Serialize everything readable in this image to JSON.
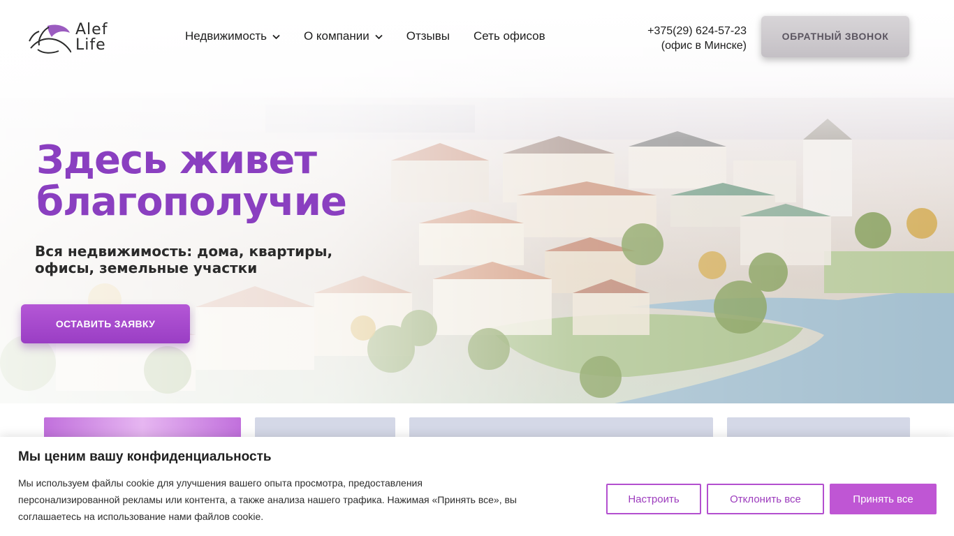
{
  "brand": {
    "line1": "Alef",
    "line2": "Life"
  },
  "nav": {
    "items": [
      {
        "label": "Недвижимость",
        "has_dropdown": true
      },
      {
        "label": "О компании",
        "has_dropdown": true
      },
      {
        "label": "Отзывы",
        "has_dropdown": false
      },
      {
        "label": "Сеть офисов",
        "has_dropdown": false
      }
    ]
  },
  "contact": {
    "phone": "+375(29) 624-57-23",
    "note": "(офис в Минске)"
  },
  "header": {
    "callback_label": "ОБРАТНЫЙ ЗВОНОК"
  },
  "hero": {
    "title_line1": "Здесь живет",
    "title_line2": "благополучие",
    "subtitle_line1": "Вся недвижимость: дома, квартиры,",
    "subtitle_line2": "офисы, земельные участки",
    "cta_label": "ОСТАВИТЬ ЗАЯВКУ"
  },
  "cookie": {
    "title": "Мы ценим вашу конфиденциальность",
    "text_line1": "Мы используем файлы cookie для улучшения вашего опыта просмотра, предоставления",
    "text_line2": "персонализированной рекламы или контента, а также анализа нашего трафика. Нажимая «Принять все», вы",
    "text_line3": "соглашаетесь на использование нами файлов cookie.",
    "settings_label": "Настроить",
    "reject_label": "Отклонить все",
    "accept_label": "Принять все"
  },
  "colors": {
    "accent": "#9a3ec4",
    "accent_light": "#bf56d4",
    "tab_bg": "#d4d8e7",
    "callback_bg": "#cbc7cc"
  }
}
